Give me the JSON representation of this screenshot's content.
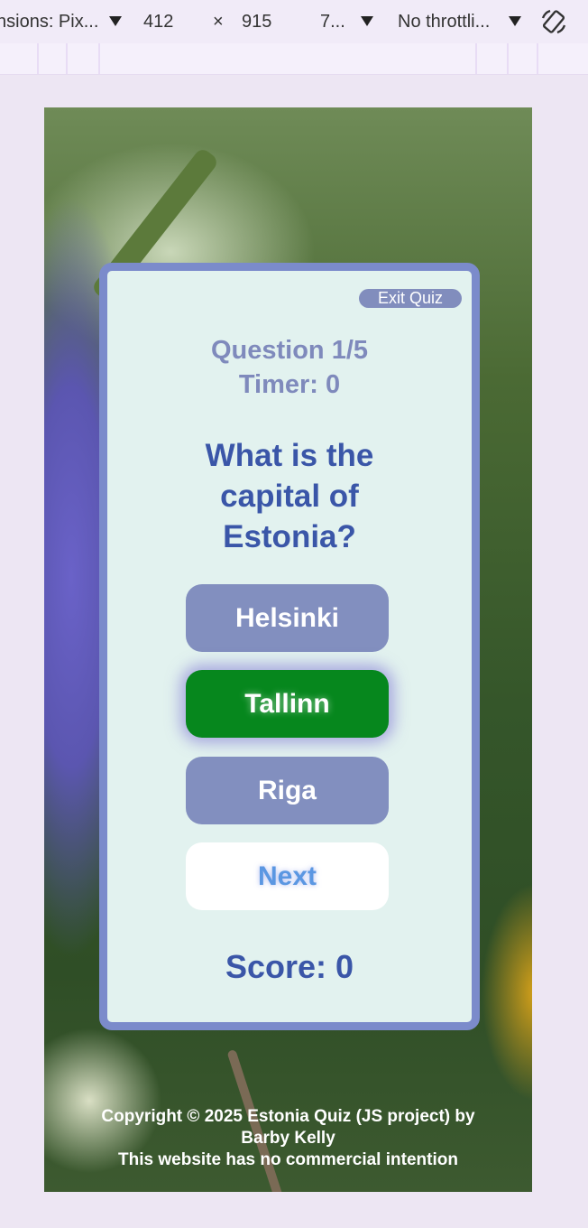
{
  "devtools": {
    "dimensions_label": "nsions: Pix...",
    "width_value": "412",
    "times_sign": "×",
    "height_value": "915",
    "zoom_value": "7...",
    "throttle_label": "No throttli..."
  },
  "quiz": {
    "exit_label": "Exit Quiz",
    "question_number": "Question 1/5",
    "timer": "Timer: 0",
    "question_lines": [
      "What is the",
      "capital of",
      "Estonia?"
    ],
    "answers": [
      {
        "label": "Helsinki",
        "state": "default"
      },
      {
        "label": "Tallinn",
        "state": "correct"
      },
      {
        "label": "Riga",
        "state": "default"
      }
    ],
    "next_label": "Next",
    "score": "Score: 0"
  },
  "footer": {
    "line1": "Copyright © 2025 Estonia Quiz (JS project) by",
    "line2": "Barby Kelly",
    "line3": "This website has no commercial intention"
  },
  "colors": {
    "card_border": "#7b8bcb",
    "card_bg": "#e2f2ef",
    "answer_default": "#828fbf",
    "answer_correct": "#06871d",
    "question_text": "#3a56a8",
    "next_text": "#5b97e2"
  }
}
